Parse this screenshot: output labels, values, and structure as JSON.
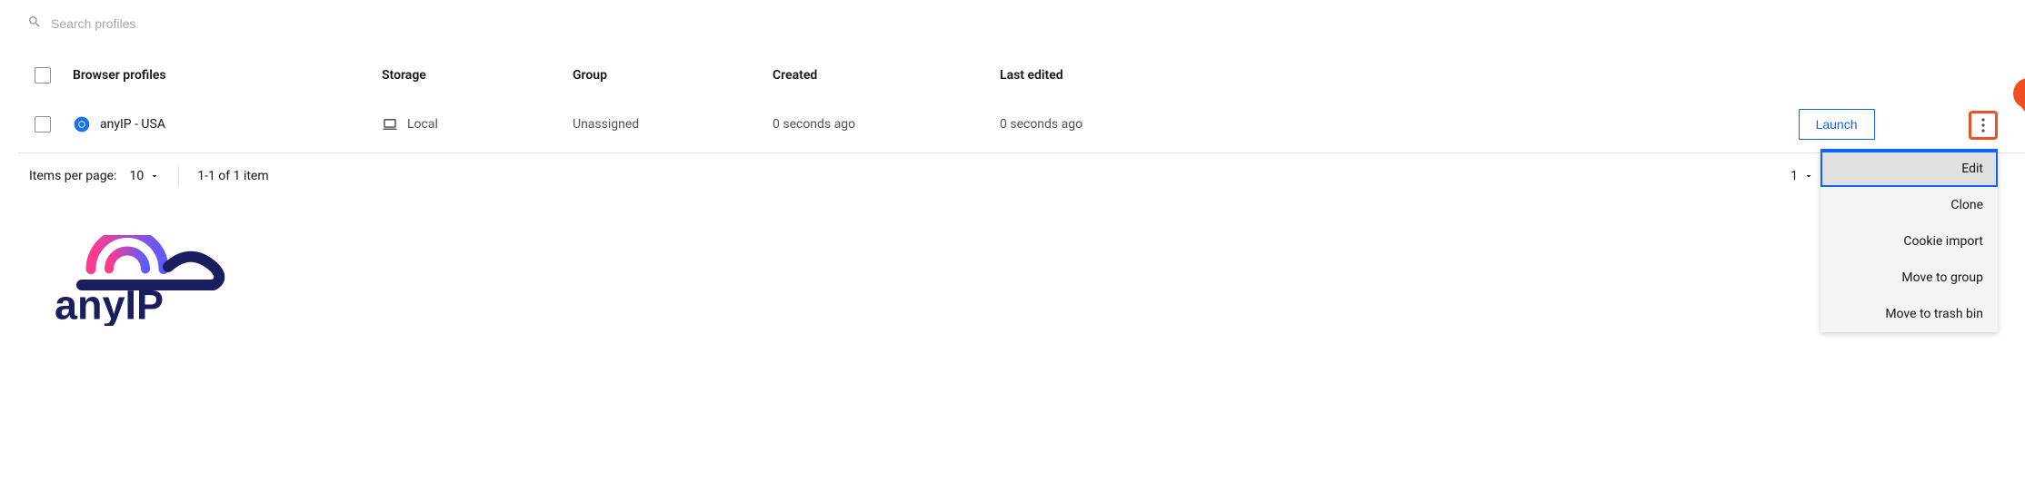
{
  "search": {
    "placeholder": "Search profiles"
  },
  "columns": {
    "profiles": "Browser profiles",
    "storage": "Storage",
    "group": "Group",
    "created": "Created",
    "edited": "Last edited"
  },
  "row": {
    "name": "anyIP - USA",
    "storage": "Local",
    "group": "Unassigned",
    "created": "0 seconds ago",
    "edited": "0 seconds ago",
    "launch": "Launch"
  },
  "marker": {
    "label": "1"
  },
  "menu": {
    "edit": "Edit",
    "clone": "Clone",
    "cookie": "Cookie import",
    "move_group": "Move to group",
    "trash": "Move to trash bin"
  },
  "pagination": {
    "label": "Items per page:",
    "per_page": "10",
    "range": "1-1 of 1 item",
    "current": "1"
  },
  "brand": {
    "name": "anyIP"
  }
}
